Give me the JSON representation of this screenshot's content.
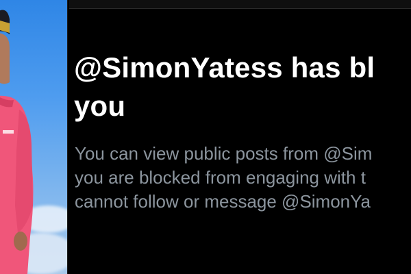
{
  "block_notice": {
    "title_line1": "@SimonYatess has bl",
    "title_line2": "you",
    "description_line1": "You can view public posts from @Sim",
    "description_line2": "you are blocked from engaging with t",
    "description_line3": "cannot follow or message @SimonYa"
  },
  "colors": {
    "background": "#000000",
    "title_text": "#ffffff",
    "description_text": "#8c959e",
    "jersey": "#f0567a"
  }
}
